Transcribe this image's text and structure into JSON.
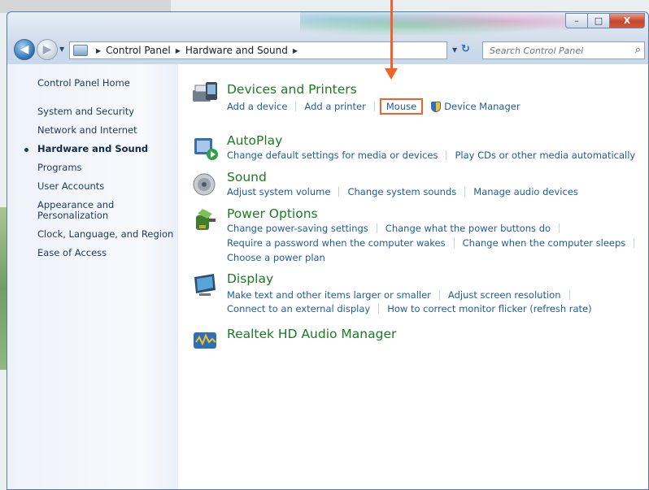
{
  "window": {
    "caption_minimize": "–",
    "caption_maximize": "□",
    "caption_close": "X"
  },
  "navbar": {
    "breadcrumbs": [
      "Control Panel",
      "Hardware and Sound"
    ],
    "search_placeholder": "Search Control Panel"
  },
  "sidebar": {
    "items": [
      {
        "label": "Control Panel Home"
      },
      {
        "label": "System and Security"
      },
      {
        "label": "Network and Internet"
      },
      {
        "label": "Hardware and Sound",
        "active": true
      },
      {
        "label": "Programs"
      },
      {
        "label": "User Accounts"
      },
      {
        "label": "Appearance and"
      },
      {
        "label": "Personalization"
      },
      {
        "label": "Clock, Language, and Region"
      },
      {
        "label": "Ease of Access"
      }
    ]
  },
  "categories": {
    "devices": {
      "title": "Devices and Printers",
      "links": [
        "Add a device",
        "Add a printer",
        "Mouse",
        "Device Manager"
      ]
    },
    "autoplay": {
      "title": "AutoPlay",
      "links": [
        "Change default settings for media or devices",
        "Play CDs or other media automatically"
      ]
    },
    "sound": {
      "title": "Sound",
      "links": [
        "Adjust system volume",
        "Change system sounds",
        "Manage audio devices"
      ]
    },
    "power": {
      "title": "Power Options",
      "links": [
        "Change power-saving settings",
        "Change what the power buttons do",
        "Require a password when the computer wakes",
        "Change when the computer sleeps",
        "Choose a power plan"
      ]
    },
    "display": {
      "title": "Display",
      "links": [
        "Make text and other items larger or smaller",
        "Adjust screen resolution",
        "Connect to an external display",
        "How to correct monitor flicker (refresh rate)"
      ]
    },
    "realtek": {
      "title": "Realtek HD Audio Manager"
    }
  },
  "colors": {
    "category_title": "#1c7a23",
    "link": "#1e5b9e",
    "highlight": "#f0622a"
  }
}
